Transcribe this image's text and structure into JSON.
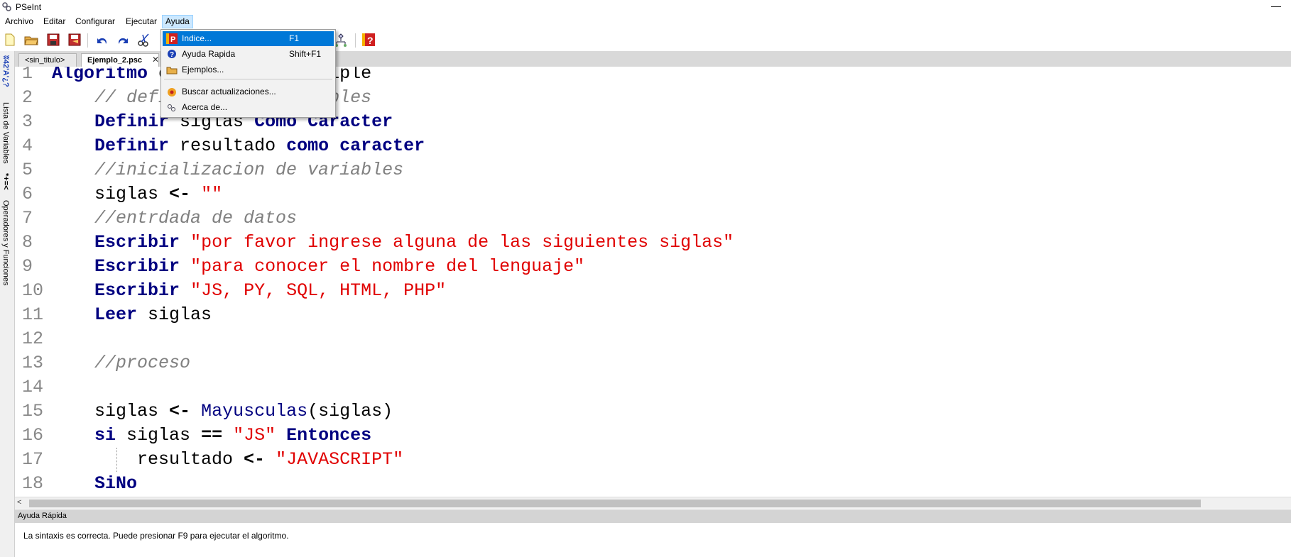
{
  "window": {
    "title": "PSeInt"
  },
  "menubar": {
    "items": [
      "Archivo",
      "Editar",
      "Configurar",
      "Ejecutar",
      "Ayuda"
    ]
  },
  "help_menu": {
    "items": [
      {
        "label": "Indice...",
        "shortcut": "F1",
        "icon": "pseint-help-icon"
      },
      {
        "label": "Ayuda Rapida",
        "shortcut": "Shift+F1",
        "icon": "quick-help-icon"
      },
      {
        "label": "Ejemplos...",
        "shortcut": "",
        "icon": "examples-folder-icon"
      },
      {
        "label": "Buscar actualizaciones...",
        "shortcut": "",
        "icon": "update-icon"
      },
      {
        "label": "Acerca de...",
        "shortcut": "",
        "icon": "about-icon"
      }
    ]
  },
  "sidebar": {
    "variables_label": "Lista de Variables",
    "operators_label": "Operadores y Funciones",
    "var_symbols": "ʬ42'A'¿?",
    "op_symbols": "*+=<"
  },
  "tabs": [
    {
      "label": "<sin_titulo>"
    },
    {
      "label": "Ejemplo_2.psc"
    }
  ],
  "editor": {
    "lines": [
      {
        "n": "1",
        "parts": [
          {
            "t": "Algoritmo",
            "c": "kw"
          },
          {
            "t": " condicional_multiple",
            "c": "txt"
          }
        ]
      },
      {
        "n": "2",
        "parts": [
          {
            "t": "    // definicion de variables",
            "c": "cmt"
          }
        ]
      },
      {
        "n": "3",
        "parts": [
          {
            "t": "    ",
            "c": "txt"
          },
          {
            "t": "Definir",
            "c": "kw"
          },
          {
            "t": " siglas ",
            "c": "txt"
          },
          {
            "t": "Como",
            "c": "kw"
          },
          {
            "t": " ",
            "c": "txt"
          },
          {
            "t": "Caracter",
            "c": "kw"
          }
        ]
      },
      {
        "n": "4",
        "parts": [
          {
            "t": "    ",
            "c": "txt"
          },
          {
            "t": "Definir",
            "c": "kw"
          },
          {
            "t": " resultado ",
            "c": "txt"
          },
          {
            "t": "como",
            "c": "kw"
          },
          {
            "t": " ",
            "c": "txt"
          },
          {
            "t": "caracter",
            "c": "kw"
          }
        ]
      },
      {
        "n": "5",
        "parts": [
          {
            "t": "    //inicializacion de variables",
            "c": "cmt"
          }
        ]
      },
      {
        "n": "6",
        "parts": [
          {
            "t": "    siglas ",
            "c": "txt"
          },
          {
            "t": "<-",
            "c": "op"
          },
          {
            "t": " ",
            "c": "txt"
          },
          {
            "t": "\"\"",
            "c": "str"
          }
        ]
      },
      {
        "n": "7",
        "parts": [
          {
            "t": "    //entrdada de datos",
            "c": "cmt"
          }
        ]
      },
      {
        "n": "8",
        "parts": [
          {
            "t": "    ",
            "c": "txt"
          },
          {
            "t": "Escribir",
            "c": "kw"
          },
          {
            "t": " ",
            "c": "txt"
          },
          {
            "t": "\"por favor ingrese alguna de las siguientes siglas\"",
            "c": "str"
          }
        ]
      },
      {
        "n": "9",
        "parts": [
          {
            "t": "    ",
            "c": "txt"
          },
          {
            "t": "Escribir",
            "c": "kw"
          },
          {
            "t": " ",
            "c": "txt"
          },
          {
            "t": "\"para conocer el nombre del lenguaje\"",
            "c": "str"
          }
        ]
      },
      {
        "n": "10",
        "parts": [
          {
            "t": "    ",
            "c": "txt"
          },
          {
            "t": "Escribir",
            "c": "kw"
          },
          {
            "t": " ",
            "c": "txt"
          },
          {
            "t": "\"JS, PY, SQL, HTML, PHP\"",
            "c": "str"
          }
        ]
      },
      {
        "n": "11",
        "parts": [
          {
            "t": "    ",
            "c": "txt"
          },
          {
            "t": "Leer",
            "c": "kw"
          },
          {
            "t": " siglas",
            "c": "txt"
          }
        ]
      },
      {
        "n": "12",
        "parts": []
      },
      {
        "n": "13",
        "parts": [
          {
            "t": "    //proceso",
            "c": "cmt"
          }
        ]
      },
      {
        "n": "14",
        "parts": []
      },
      {
        "n": "15",
        "parts": [
          {
            "t": "    siglas ",
            "c": "txt"
          },
          {
            "t": "<-",
            "c": "op"
          },
          {
            "t": " ",
            "c": "txt"
          },
          {
            "t": "Mayusculas",
            "c": "fn"
          },
          {
            "t": "(siglas)",
            "c": "txt"
          }
        ]
      },
      {
        "n": "16",
        "parts": [
          {
            "t": "    ",
            "c": "txt"
          },
          {
            "t": "si",
            "c": "kw"
          },
          {
            "t": " siglas ",
            "c": "txt"
          },
          {
            "t": "==",
            "c": "op"
          },
          {
            "t": " ",
            "c": "txt"
          },
          {
            "t": "\"JS\"",
            "c": "str"
          },
          {
            "t": " ",
            "c": "txt"
          },
          {
            "t": "Entonces",
            "c": "kw"
          }
        ]
      },
      {
        "n": "17",
        "parts": [
          {
            "t": "        resultado ",
            "c": "txt"
          },
          {
            "t": "<-",
            "c": "op"
          },
          {
            "t": " ",
            "c": "txt"
          },
          {
            "t": "\"JAVASCRIPT\"",
            "c": "str"
          }
        ]
      },
      {
        "n": "18",
        "parts": [
          {
            "t": "    ",
            "c": "txt"
          },
          {
            "t": "SiNo",
            "c": "kw"
          }
        ]
      }
    ]
  },
  "help_panel": {
    "title": "Ayuda Rápida",
    "message": "La sintaxis es correcta. Puede presionar F9 para ejecutar el algoritmo."
  },
  "colors": {
    "keyword": "#000080",
    "string": "#e00000",
    "comment": "#808080",
    "menu_highlight": "#0078d7"
  }
}
